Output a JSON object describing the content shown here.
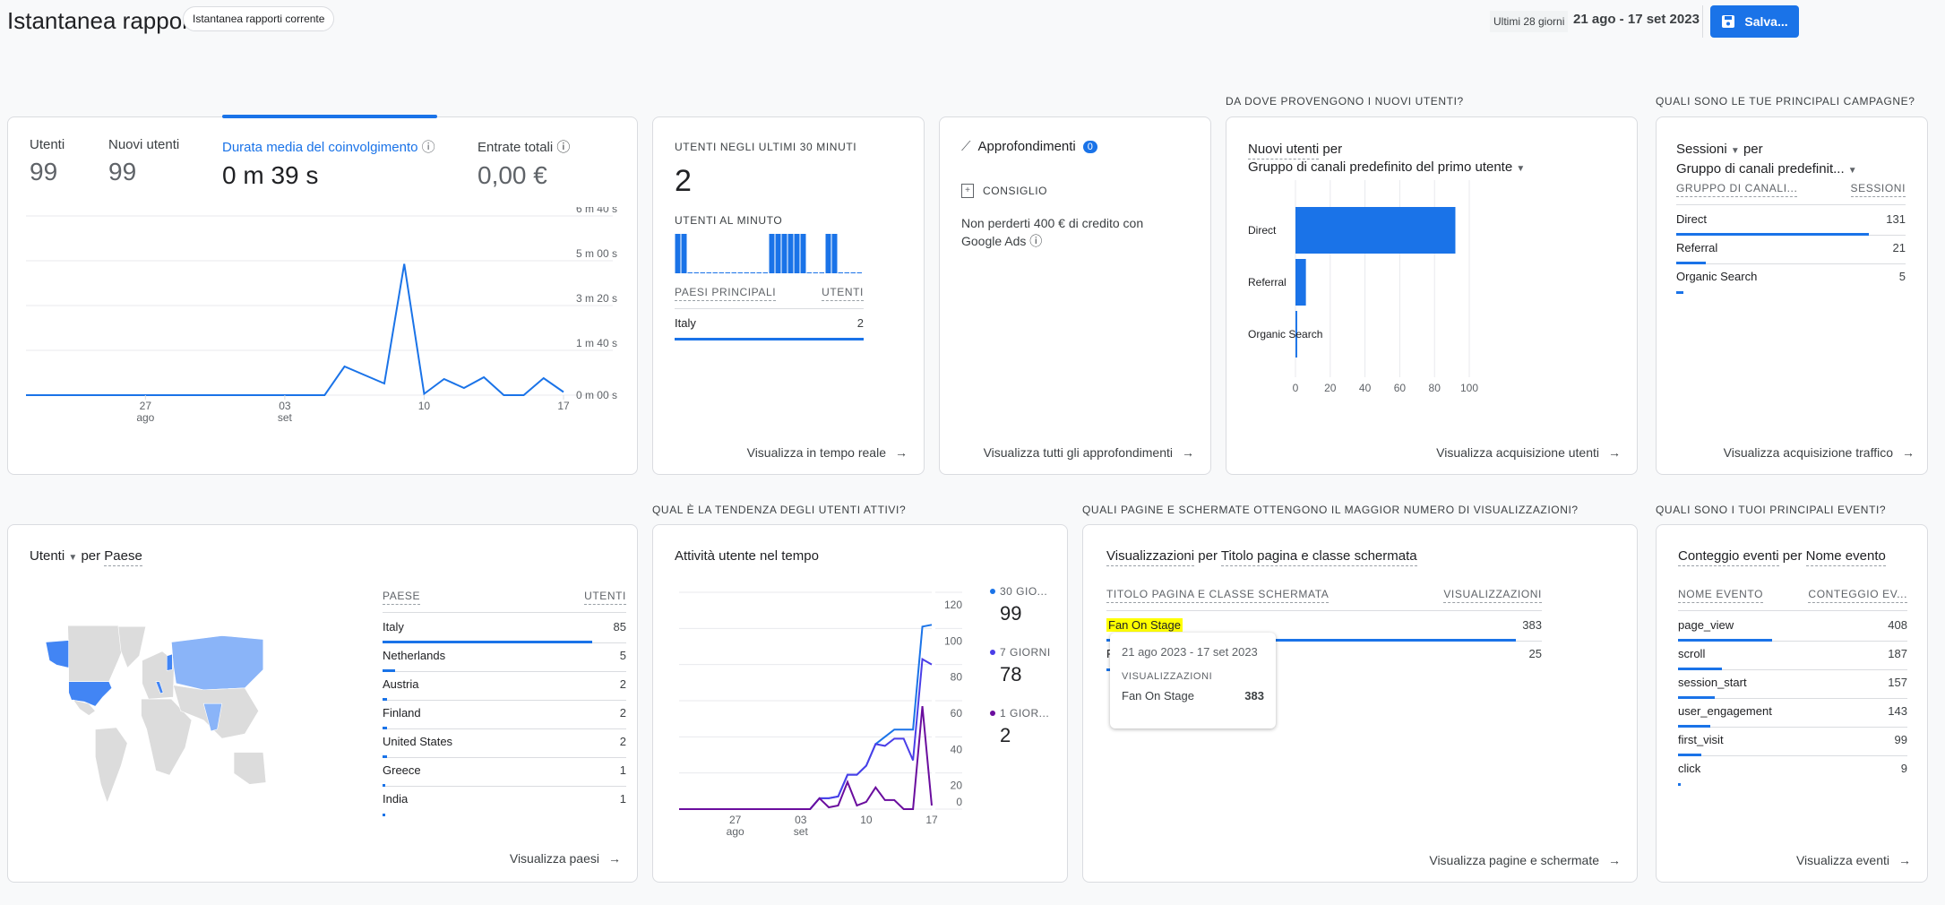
{
  "header": {
    "title": "Istantanea rapporti",
    "chip": "Istantanea rapporti corrente",
    "range_label": "Ultimi 28 giorni",
    "range": "21 ago - 17 set 2023",
    "save": "Salva...",
    "icons": {
      "save": "floppy-disk-icon"
    }
  },
  "accent": "#1a73e8",
  "overview": {
    "kpis": [
      {
        "label": "Utenti",
        "value": "99"
      },
      {
        "label": "Nuovi utenti",
        "value": "99"
      },
      {
        "label": "Durata media del coinvolgimento",
        "value": "0 m 39 s",
        "selected": true
      },
      {
        "label": "Entrate totali",
        "value": "0,00 €"
      }
    ],
    "chart_data": {
      "type": "line",
      "x": [
        "21 ago",
        "22 ago",
        "23 ago",
        "24 ago",
        "25 ago",
        "26 ago",
        "27 ago",
        "28 ago",
        "29 ago",
        "30 ago",
        "31 ago",
        "01 set",
        "02 set",
        "03 set",
        "04 set",
        "05 set",
        "06 set",
        "07 set",
        "08 set",
        "09 set",
        "10 set",
        "11 set",
        "12 set",
        "13 set",
        "14 set",
        "15 set",
        "16 set",
        "17 set"
      ],
      "values_seconds": [
        0,
        0,
        0,
        0,
        0,
        0,
        0,
        0,
        0,
        0,
        0,
        0,
        0,
        0,
        0,
        0,
        64,
        45,
        26,
        293,
        3,
        36,
        16,
        40,
        0,
        0,
        38,
        7
      ],
      "yticks": [
        "0 m 00 s",
        "1 m 40 s",
        "3 m 20 s",
        "5 m 00 s",
        "6 m 40 s"
      ],
      "ylim": [
        0,
        400
      ],
      "xticks": [
        {
          "day": "27",
          "month": "ago"
        },
        {
          "day": "03",
          "month": "set"
        },
        {
          "day": "10",
          "month": ""
        },
        {
          "day": "17",
          "month": ""
        }
      ],
      "color": "#1a73e8",
      "grid": true
    }
  },
  "realtime": {
    "title": "Utenti negli ultimi 30 minuti",
    "value": "2",
    "per_minute_label": "Utenti al minuto",
    "chart_data": {
      "type": "bar",
      "values": [
        1,
        1,
        0,
        0,
        0,
        0,
        0,
        0,
        0,
        0,
        0,
        0,
        0,
        0,
        0,
        1,
        1,
        1,
        1,
        1,
        1,
        0,
        0,
        0,
        1,
        1,
        0,
        0,
        0,
        0
      ]
    },
    "table": {
      "col1": "Paesi principali",
      "col2": "Utenti",
      "rows": [
        {
          "name": "Italy",
          "value": "2",
          "pct": 100
        }
      ]
    },
    "link": "Visualizza in tempo reale"
  },
  "insights": {
    "title": "Approfondimenti",
    "badge": "0",
    "tag": "Consiglio",
    "text": "Non perderti 400 € di credito con Google Ads",
    "link": "Visualizza tutti gli approfondimenti"
  },
  "acquisition": {
    "section": "Da dove provengono i nuovi utenti?",
    "metric": "Nuovi utenti",
    "per": "per",
    "dimension": "Gruppo di canali predefinito del primo utente",
    "chart_data": {
      "type": "bar",
      "orientation": "horizontal",
      "categories": [
        "Direct",
        "Referral",
        "Organic Search"
      ],
      "values": [
        92,
        6,
        1
      ],
      "xlim": [
        0,
        100
      ],
      "xticks": [
        "0",
        "20",
        "40",
        "60",
        "80",
        "100"
      ],
      "grid": true
    },
    "link": "Visualizza acquisizione utenti"
  },
  "campaigns": {
    "section": "Quali sono le tue principali campagne?",
    "metric": "Sessioni",
    "per": "per",
    "dimension": "Gruppo di canali predefinit...",
    "col1": "Gruppo di canali...",
    "col2": "Sessioni",
    "rows": [
      {
        "name": "Direct",
        "value": "131",
        "pct": 84
      },
      {
        "name": "Referral",
        "value": "21",
        "pct": 13
      },
      {
        "name": "Organic Search",
        "value": "5",
        "pct": 3
      }
    ],
    "link": "Visualizza acquisizione traffico"
  },
  "countries": {
    "metric": "Utenti",
    "per": "per",
    "dimension": "Paese",
    "col1": "Paese",
    "col2": "Utenti",
    "rows": [
      {
        "name": "Italy",
        "value": "85",
        "pct": 86
      },
      {
        "name": "Netherlands",
        "value": "5",
        "pct": 5
      },
      {
        "name": "Austria",
        "value": "2",
        "pct": 2
      },
      {
        "name": "Finland",
        "value": "2",
        "pct": 2
      },
      {
        "name": "United States",
        "value": "2",
        "pct": 2
      },
      {
        "name": "Greece",
        "value": "1",
        "pct": 1
      },
      {
        "name": "India",
        "value": "1",
        "pct": 1
      }
    ],
    "map_colors": {
      "base": "#dcdcdc",
      "high": "#4285f4",
      "low": "#8ab4f8"
    },
    "link": "Visualizza paesi"
  },
  "activity": {
    "section": "Qual è la tendenza degli utenti attivi?",
    "title": "Attività utente nel tempo",
    "chart_data": {
      "type": "line",
      "x": [
        "21 ago",
        "22 ago",
        "23 ago",
        "24 ago",
        "25 ago",
        "26 ago",
        "27 ago",
        "28 ago",
        "29 ago",
        "30 ago",
        "31 ago",
        "01 set",
        "02 set",
        "03 set",
        "04 set",
        "05 set",
        "06 set",
        "07 set",
        "08 set",
        "09 set",
        "10 set",
        "11 set",
        "12 set",
        "13 set",
        "14 set",
        "15 set",
        "16 set",
        "17 set"
      ],
      "ylim": [
        0,
        120
      ],
      "yticks": [
        "0",
        "20",
        "40",
        "60",
        "80",
        "100",
        "120"
      ],
      "xticks": [
        {
          "day": "27",
          "month": "ago"
        },
        {
          "day": "03",
          "month": "set"
        },
        {
          "day": "10",
          "month": ""
        },
        {
          "day": "17",
          "month": ""
        }
      ],
      "series": [
        {
          "name": "30 GIO...",
          "total": "99",
          "color": "#1a73e8",
          "values": [
            0,
            0,
            0,
            0,
            0,
            0,
            0,
            0,
            0,
            0,
            0,
            0,
            0,
            0,
            0,
            6,
            6,
            7,
            19,
            19,
            24,
            36,
            40,
            44,
            44,
            44,
            101,
            102
          ]
        },
        {
          "name": "7 GIORNI",
          "total": "78",
          "color": "#4a3ee8",
          "values": [
            0,
            0,
            0,
            0,
            0,
            0,
            0,
            0,
            0,
            0,
            0,
            0,
            0,
            0,
            0,
            6,
            6,
            7,
            19,
            19,
            24,
            36,
            35,
            39,
            39,
            27,
            83,
            80
          ]
        },
        {
          "name": "1 GIOR...",
          "total": "2",
          "color": "#6a0d9e",
          "values": [
            0,
            0,
            0,
            0,
            0,
            0,
            0,
            0,
            0,
            0,
            0,
            0,
            0,
            0,
            0,
            6,
            1,
            2,
            15,
            2,
            4,
            12,
            5,
            5,
            0,
            0,
            57,
            2
          ]
        }
      ]
    }
  },
  "pages": {
    "section": "Quali pagine e schermate ottengono il maggior numero di visualizzazioni?",
    "metric": "Visualizzazioni",
    "per": "per",
    "dimension": "Titolo pagina e classe schermata",
    "col1": "Titolo pagina e classe schermata",
    "col2": "Visualizzazioni",
    "rows": [
      {
        "name": "Fan On Stage",
        "value": "383",
        "pct": 94
      },
      {
        "name": "F",
        "value": "25",
        "pct": 6
      }
    ],
    "tooltip": {
      "range": "21 ago 2023 - 17 set 2023",
      "label": "Visualizzazioni",
      "name": "Fan On Stage",
      "value": "383"
    },
    "highlight": "#ffff00",
    "link": "Visualizza pagine e schermate"
  },
  "events": {
    "section": "Quali sono i tuoi principali eventi?",
    "metric": "Conteggio eventi",
    "per": "per",
    "dimension": "Nome evento",
    "col1": "Nome evento",
    "col2": "Conteggio ev...",
    "rows": [
      {
        "name": "page_view",
        "value": "408",
        "pct": 41
      },
      {
        "name": "scroll",
        "value": "187",
        "pct": 19
      },
      {
        "name": "session_start",
        "value": "157",
        "pct": 16
      },
      {
        "name": "user_engagement",
        "value": "143",
        "pct": 14
      },
      {
        "name": "first_visit",
        "value": "99",
        "pct": 10
      },
      {
        "name": "click",
        "value": "9",
        "pct": 1
      }
    ],
    "link": "Visualizza eventi"
  }
}
